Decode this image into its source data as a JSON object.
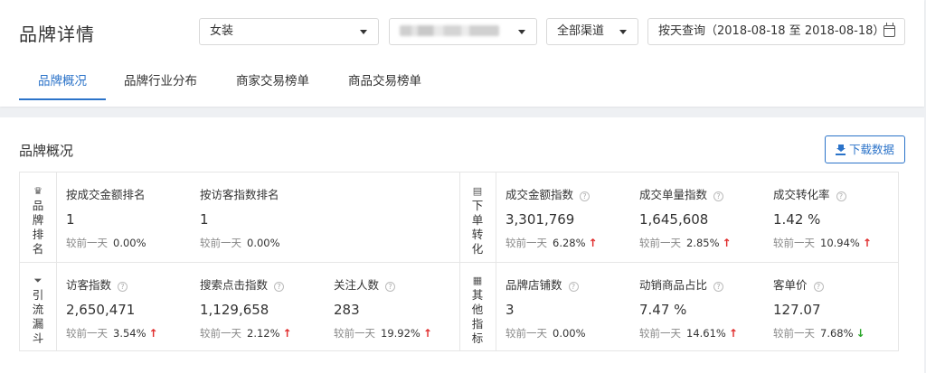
{
  "header": {
    "title": "品牌详情",
    "filters": {
      "category": "女装",
      "brand_masked": "",
      "channel": "全部渠道",
      "date_range": "按天查询（2018-08-18 至 2018-08-18）"
    },
    "tabs": [
      "品牌概况",
      "品牌行业分布",
      "商家交易榜单",
      "商品交易榜单"
    ],
    "active_tab": 0
  },
  "panel": {
    "title": "品牌概况",
    "download_label": "下载数据",
    "compare_prefix": "较前一天",
    "sections": {
      "rank": {
        "label": "品牌排名",
        "icon": "crown-icon",
        "metrics": [
          {
            "label": "按成交金额排名",
            "value": "1",
            "change": "0.00%",
            "trend": "none",
            "help": false
          },
          {
            "label": "按访客指数排名",
            "value": "1",
            "change": "0.00%",
            "trend": "none",
            "help": false
          }
        ]
      },
      "conversion": {
        "label": "下单转化",
        "icon": "document-icon",
        "metrics": [
          {
            "label": "成交金额指数",
            "value": "3,301,769",
            "change": "6.28%",
            "trend": "up",
            "help": true
          },
          {
            "label": "成交单量指数",
            "value": "1,645,608",
            "change": "2.85%",
            "trend": "up",
            "help": true
          },
          {
            "label": "成交转化率",
            "value": "1.42 %",
            "change": "10.94%",
            "trend": "up",
            "help": true
          }
        ]
      },
      "traffic": {
        "label": "引流漏斗",
        "icon": "funnel-icon",
        "metrics": [
          {
            "label": "访客指数",
            "value": "2,650,471",
            "change": "3.54%",
            "trend": "up",
            "help": true
          },
          {
            "label": "搜索点击指数",
            "value": "1,129,658",
            "change": "2.12%",
            "trend": "up",
            "help": true
          },
          {
            "label": "关注人数",
            "value": "283",
            "change": "19.92%",
            "trend": "up",
            "help": true
          }
        ]
      },
      "other": {
        "label": "其他指标",
        "icon": "grid-icon",
        "metrics": [
          {
            "label": "品牌店铺数",
            "value": "3",
            "change": "0.00%",
            "trend": "none",
            "help": true
          },
          {
            "label": "动销商品占比",
            "value": "7.47 %",
            "change": "14.61%",
            "trend": "up",
            "help": true
          },
          {
            "label": "客单价",
            "value": "127.07",
            "change": "7.68%",
            "trend": "down",
            "help": true
          }
        ]
      }
    }
  },
  "colors": {
    "accent": "#2b73c9",
    "up": "#e02b2b",
    "down": "#2aa52a"
  }
}
